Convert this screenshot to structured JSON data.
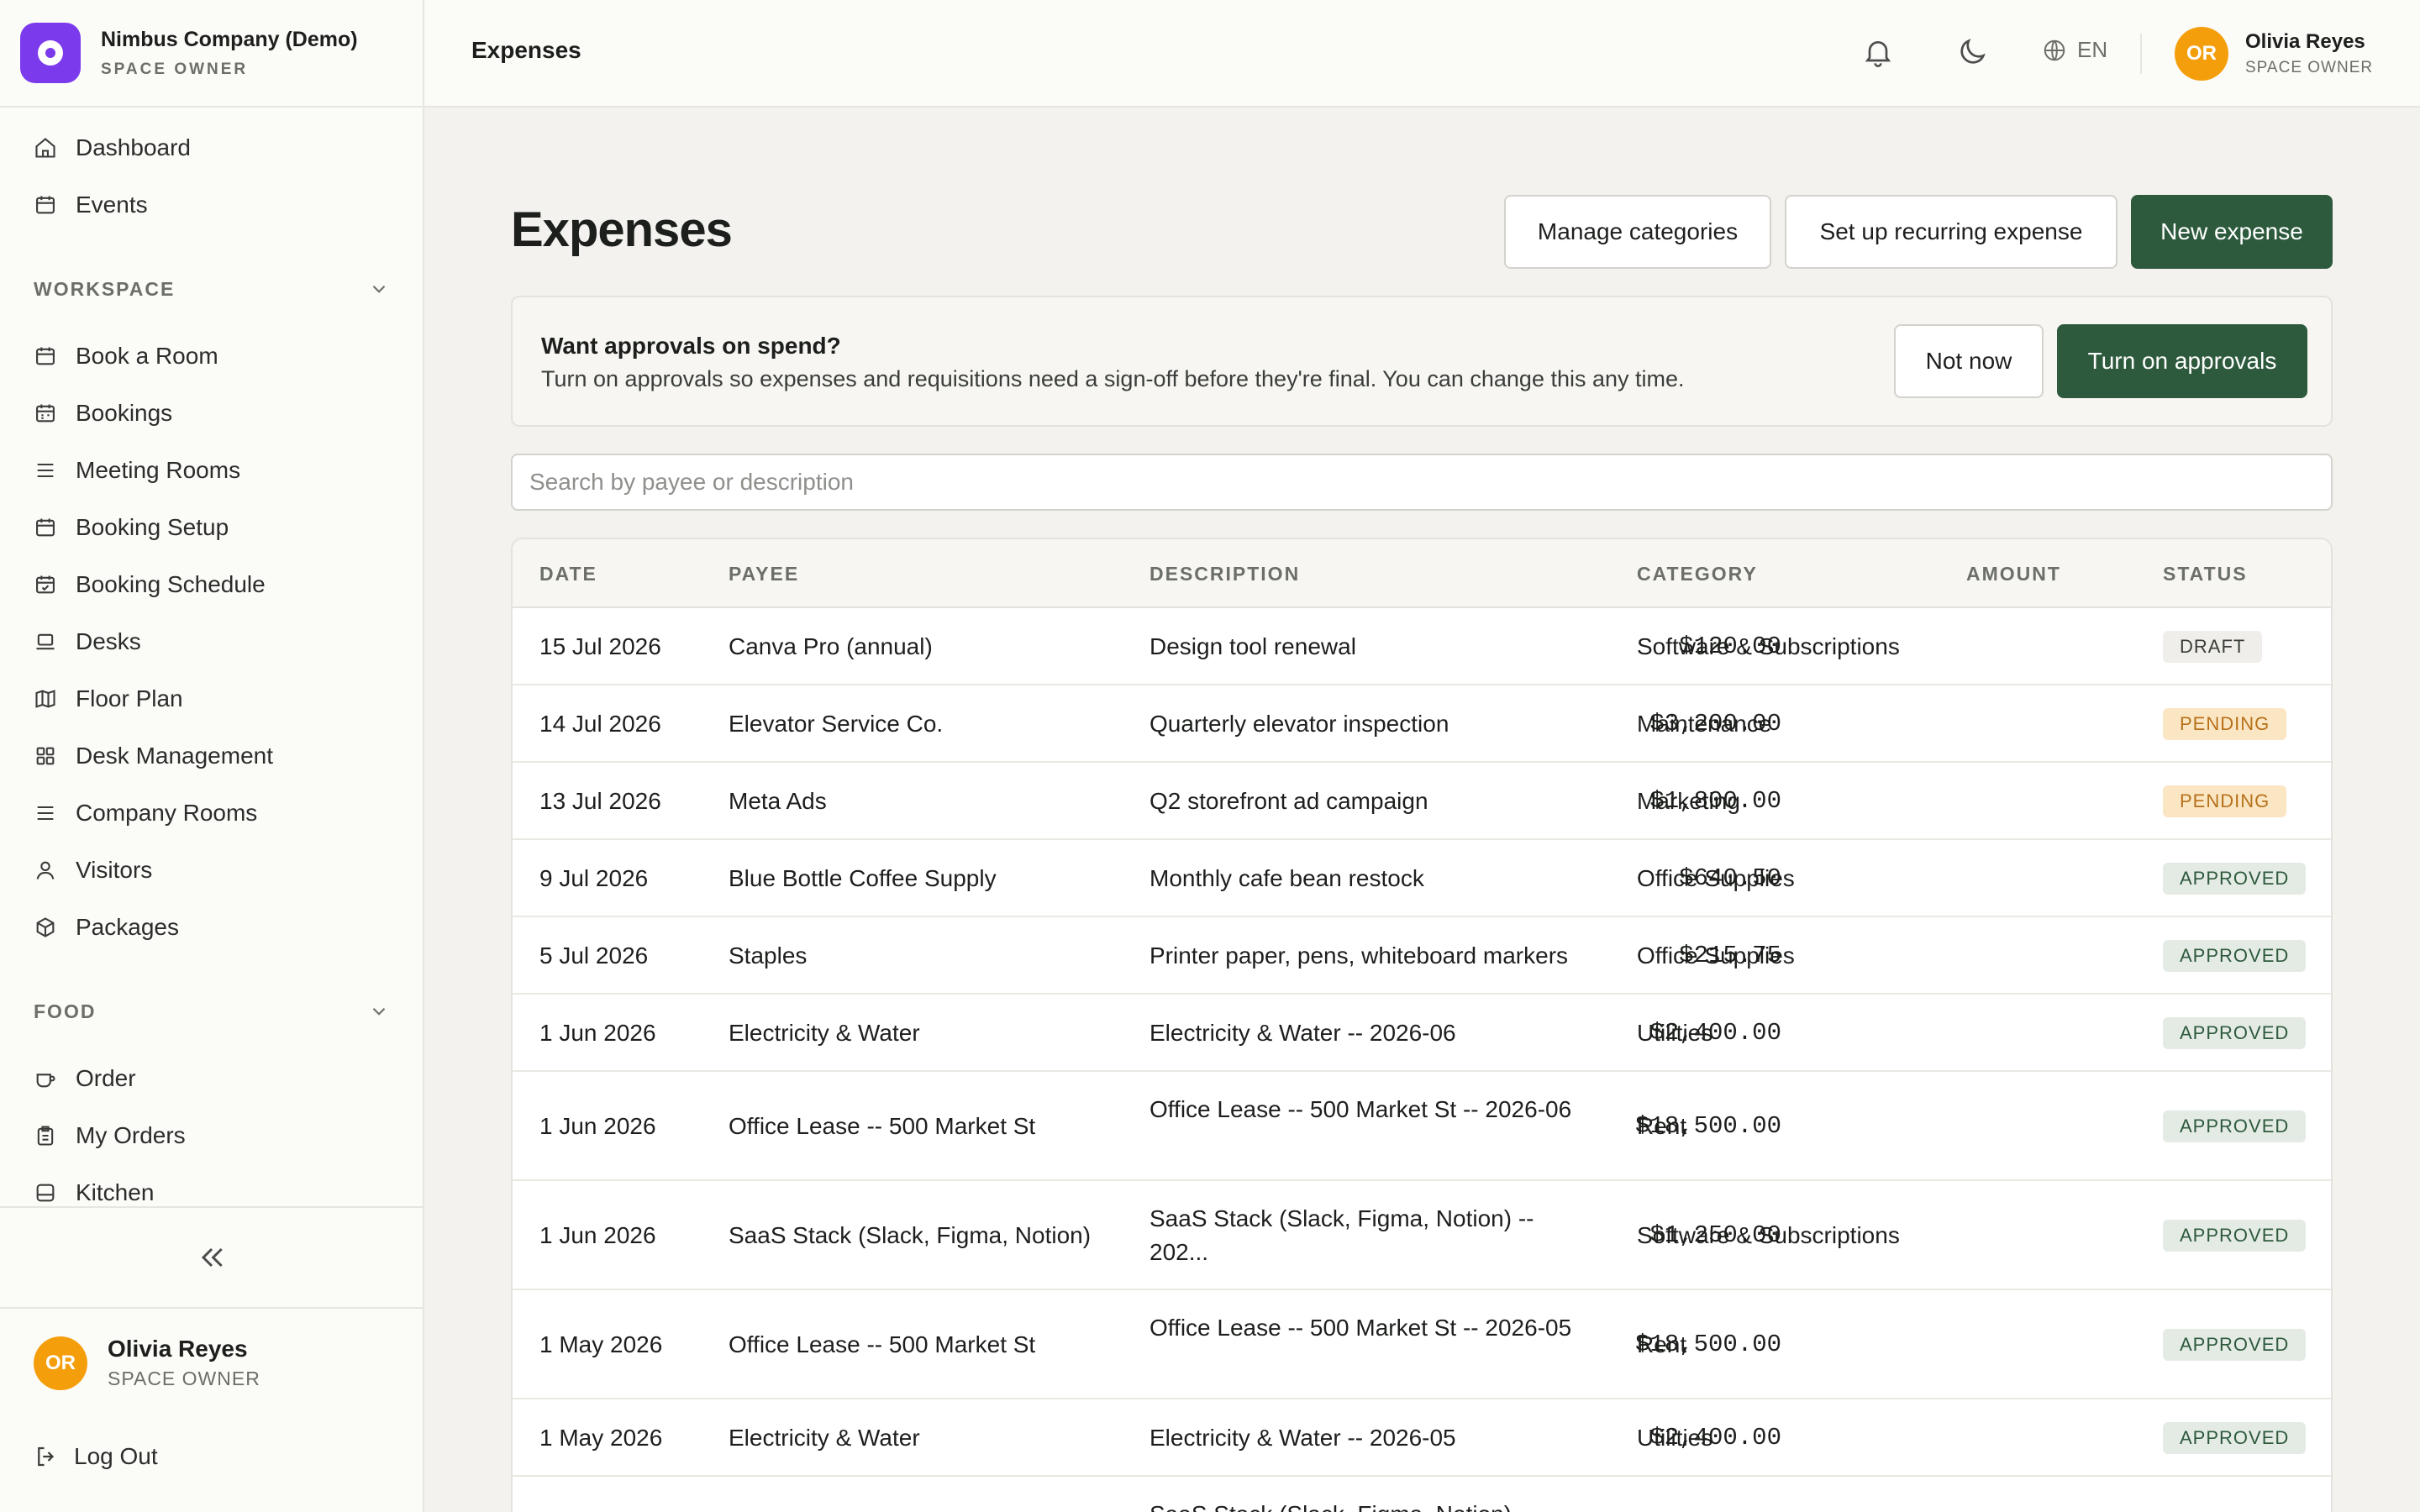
{
  "brand": {
    "name": "Nimbus Company (Demo)",
    "role": "SPACE OWNER"
  },
  "nav": {
    "top_items": [
      {
        "label": "Dashboard",
        "icon": "home-icon"
      },
      {
        "label": "Events",
        "icon": "calendar-icon"
      }
    ],
    "workspace": {
      "title": "WORKSPACE",
      "items": [
        {
          "label": "Book a Room",
          "icon": "calendar-icon"
        },
        {
          "label": "Bookings",
          "icon": "calendar-grid-icon"
        },
        {
          "label": "Meeting Rooms",
          "icon": "list-icon"
        },
        {
          "label": "Booking Setup",
          "icon": "calendar-icon"
        },
        {
          "label": "Booking Schedule",
          "icon": "calendar-check-icon"
        },
        {
          "label": "Desks",
          "icon": "laptop-icon"
        },
        {
          "label": "Floor Plan",
          "icon": "map-icon"
        },
        {
          "label": "Desk Management",
          "icon": "grid-icon"
        },
        {
          "label": "Company Rooms",
          "icon": "list-icon"
        },
        {
          "label": "Visitors",
          "icon": "user-icon"
        },
        {
          "label": "Packages",
          "icon": "package-icon"
        }
      ]
    },
    "food": {
      "title": "FOOD",
      "items": [
        {
          "label": "Order",
          "icon": "cup-icon"
        },
        {
          "label": "My Orders",
          "icon": "clipboard-icon"
        },
        {
          "label": "Kitchen",
          "icon": "kitchen-icon"
        }
      ]
    }
  },
  "sidebar_user": {
    "initials": "OR",
    "name": "Olivia Reyes",
    "role": "SPACE OWNER"
  },
  "logout_label": "Log Out",
  "topbar": {
    "title": "Expenses",
    "language": "EN",
    "user": {
      "initials": "OR",
      "name": "Olivia Reyes",
      "role": "SPACE OWNER"
    }
  },
  "page": {
    "title": "Expenses",
    "buttons": {
      "manage_categories": "Manage categories",
      "recurring": "Set up recurring expense",
      "new_expense": "New expense"
    }
  },
  "banner": {
    "heading": "Want approvals on spend?",
    "body": "Turn on approvals so expenses and requisitions need a sign-off before they're final. You can change this any time.",
    "not_now": "Not now",
    "turn_on": "Turn on approvals"
  },
  "search": {
    "placeholder": "Search by payee or description"
  },
  "table": {
    "columns": {
      "date": "DATE",
      "payee": "PAYEE",
      "description": "DESCRIPTION",
      "category": "CATEGORY",
      "amount": "AMOUNT",
      "status": "STATUS"
    },
    "rows": [
      {
        "date": "15 Jul 2026",
        "payee": "Canva Pro (annual)",
        "description": "Design tool renewal",
        "category": "Software & Subscriptions",
        "amount": "$120.00",
        "status": "DRAFT"
      },
      {
        "date": "14 Jul 2026",
        "payee": "Elevator Service Co.",
        "description": "Quarterly elevator inspection",
        "category": "Maintenance",
        "amount": "$3,200.00",
        "status": "PENDING"
      },
      {
        "date": "13 Jul 2026",
        "payee": "Meta Ads",
        "description": "Q2 storefront ad campaign",
        "category": "Marketing",
        "amount": "$1,800.00",
        "status": "PENDING"
      },
      {
        "date": "9 Jul 2026",
        "payee": "Blue Bottle Coffee Supply",
        "description": "Monthly cafe bean restock",
        "category": "Office Supplies",
        "amount": "$640.50",
        "status": "APPROVED"
      },
      {
        "date": "5 Jul 2026",
        "payee": "Staples",
        "description": "Printer paper, pens, whiteboard markers",
        "category": "Office Supplies",
        "amount": "$215.75",
        "status": "APPROVED"
      },
      {
        "date": "1 Jun 2026",
        "payee": "Electricity & Water",
        "description": "Electricity & Water -- 2026-06",
        "category": "Utilities",
        "amount": "$2,400.00",
        "status": "APPROVED"
      },
      {
        "date": "1 Jun 2026",
        "payee": "Office Lease -- 500 Market St",
        "description": "Office Lease -- 500 Market St -- 2026-06",
        "category": "Rent",
        "amount": "$18,500.00",
        "status": "APPROVED"
      },
      {
        "date": "1 Jun 2026",
        "payee": "SaaS Stack (Slack, Figma, Notion)",
        "description": "SaaS Stack (Slack, Figma, Notion) -- 202...",
        "category": "Software & Subscriptions",
        "amount": "$1,250.00",
        "status": "APPROVED"
      },
      {
        "date": "1 May 2026",
        "payee": "Office Lease -- 500 Market St",
        "description": "Office Lease -- 500 Market St -- 2026-05",
        "category": "Rent",
        "amount": "$18,500.00",
        "status": "APPROVED"
      },
      {
        "date": "1 May 2026",
        "payee": "Electricity & Water",
        "description": "Electricity & Water -- 2026-05",
        "category": "Utilities",
        "amount": "$2,400.00",
        "status": "APPROVED"
      },
      {
        "date": "",
        "payee": "",
        "description": "SaaS Stack (Slack, Figma, Notion)",
        "category": "",
        "amount": "",
        "status": ""
      }
    ]
  },
  "status_colors": {
    "DRAFT": {
      "bg": "#efeeea",
      "fg": "#3a3d3a"
    },
    "PENDING": {
      "bg": "#fbe6c4",
      "fg": "#b7701a"
    },
    "APPROVED": {
      "bg": "#e4ebe4",
      "fg": "#2d5a3d"
    }
  },
  "colors": {
    "primary": "#2d5a3d",
    "brand": "#7c3aed",
    "avatar": "#f59e0b"
  }
}
